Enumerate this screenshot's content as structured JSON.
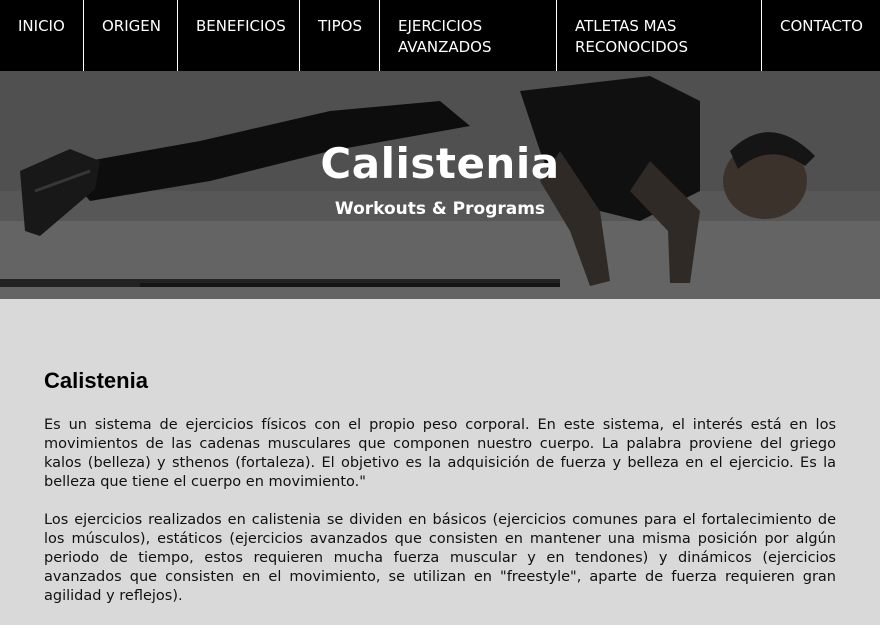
{
  "nav": {
    "items": [
      {
        "label": "INICIO"
      },
      {
        "label": "ORIGEN"
      },
      {
        "label": "BENEFICIOS"
      },
      {
        "label": "TIPOS"
      },
      {
        "label": "EJERCICIOS AVANZADOS"
      },
      {
        "label": "ATLETAS MAS RECONOCIDOS"
      },
      {
        "label": "CONTACTO"
      }
    ]
  },
  "hero": {
    "title": "Calistenia",
    "subtitle": "Workouts & Programs"
  },
  "main": {
    "heading": "Calistenia",
    "paragraphs": [
      "Es un sistema de ejercicios físicos con el propio peso corporal. En este sistema, el interés está en los movimientos de las cadenas musculares que componen nuestro cuerpo. La palabra proviene del griego kalos (belleza) y sthenos (fortaleza). El objetivo es la adquisición de fuerza y belleza en el ejercicio. Es la belleza que tiene el cuerpo en movimiento.\"",
      "Los ejercicios realizados en calistenia se dividen en básicos (ejercicios comunes para el fortalecimiento de los músculos), estáticos (ejercicios avanzados que consisten en mantener una misma posición por algún periodo de tiempo, estos requieren mucha fuerza muscular y en tendones) y dinámicos (ejercicios avanzados que consisten en el movimiento, se utilizan en \"freestyle\", aparte de fuerza requieren gran agilidad y reflejos)."
    ]
  },
  "colors": {
    "nav_bg": "#000000",
    "nav_text": "#ffffff",
    "page_bg": "#d9d9d9"
  }
}
